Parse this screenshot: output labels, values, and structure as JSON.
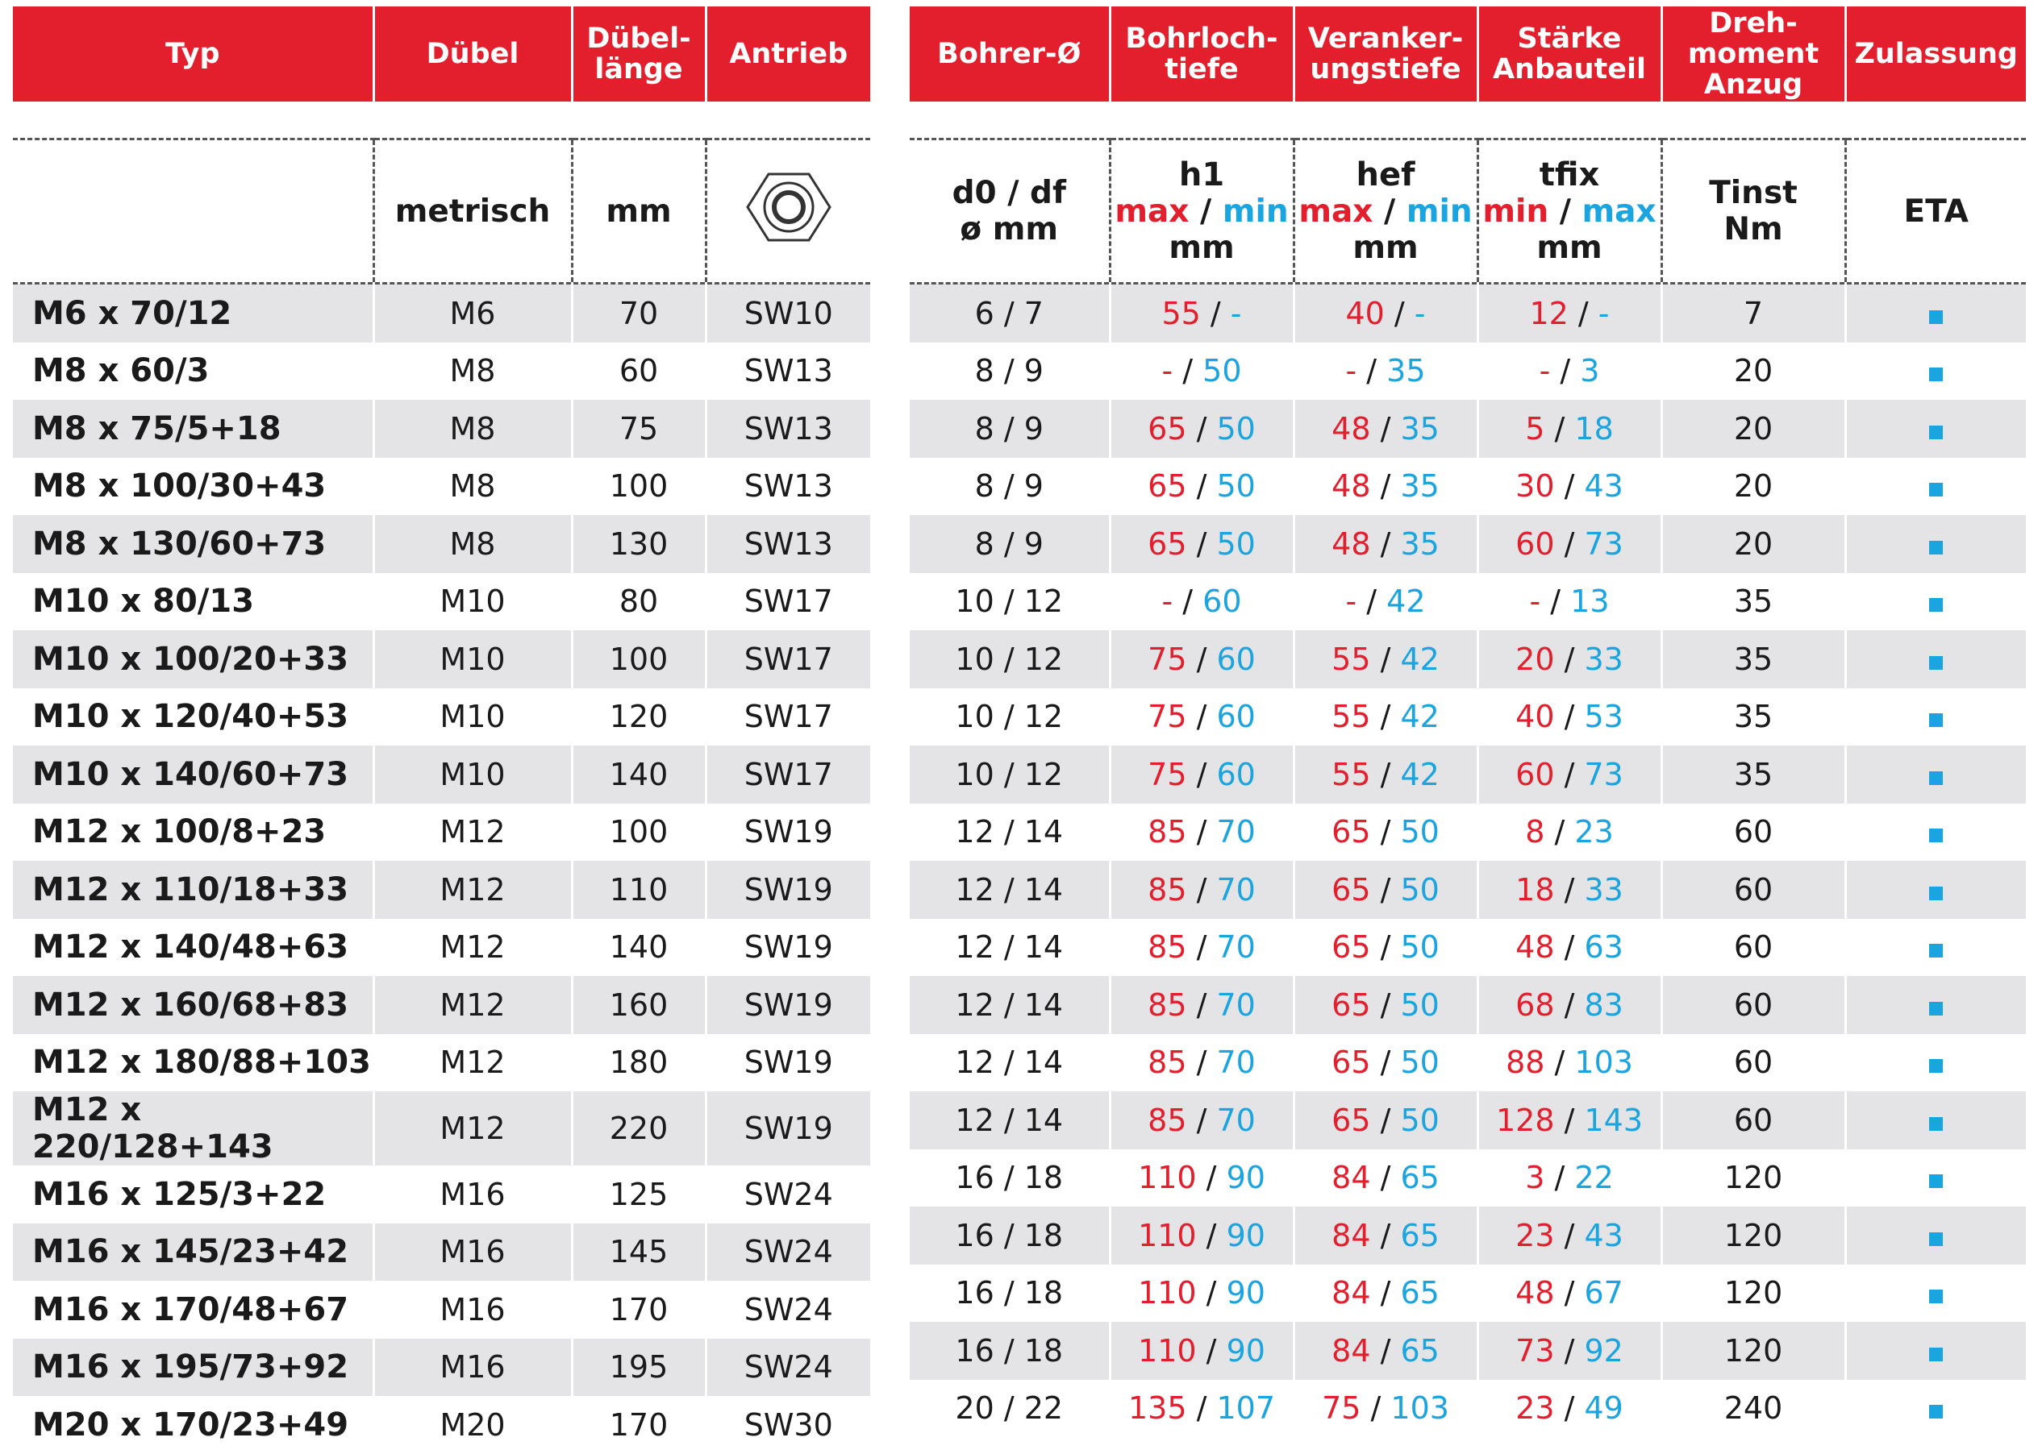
{
  "left_header": [
    "Typ",
    "Dübel",
    "Dübel-\nlänge",
    "Antrieb"
  ],
  "right_header": [
    "Bohrer-Ø",
    "Bohrloch-\ntiefe",
    "Veranker-\nungstiefe",
    "Stärke\nAnbauteil",
    "Dreh-\nmoment\nAnzug",
    "Zulassung"
  ],
  "units": {
    "metrisch": "metrisch",
    "mm": "mm",
    "drive_icon": "hex-nut-icon",
    "d0_df": "d0 / df",
    "d0_df_unit": "ø mm",
    "h1": "h1",
    "hef": "hef",
    "tfix": "tfix",
    "max": "max",
    "min": "min",
    "slash": " / ",
    "unit_mm": "mm",
    "tinst": "Tinst",
    "nm": "Nm",
    "eta": "ETA"
  },
  "colors": {
    "header_red": "#e31e2d",
    "max_red": "#e31e2d",
    "min_blue": "#1aa4e0",
    "stripe": "#e4e4e6"
  },
  "rows": [
    {
      "typ": "M6 x 70/12",
      "duebel": "M6",
      "laenge": "70",
      "antrieb": "SW10",
      "bohrer": "6 / 7",
      "h1": [
        "55",
        "-"
      ],
      "hef": [
        "40",
        "-"
      ],
      "tfix": [
        "12",
        "-"
      ],
      "tinst": "7"
    },
    {
      "typ": "M8 x 60/3",
      "duebel": "M8",
      "laenge": "60",
      "antrieb": "SW13",
      "bohrer": "8 / 9",
      "h1": [
        "-",
        "50"
      ],
      "hef": [
        "-",
        "35"
      ],
      "tfix": [
        "-",
        "3"
      ],
      "tinst": "20"
    },
    {
      "typ": "M8 x 75/5+18",
      "duebel": "M8",
      "laenge": "75",
      "antrieb": "SW13",
      "bohrer": "8 / 9",
      "h1": [
        "65",
        "50"
      ],
      "hef": [
        "48",
        "35"
      ],
      "tfix": [
        "5",
        "18"
      ],
      "tinst": "20"
    },
    {
      "typ": "M8 x 100/30+43",
      "duebel": "M8",
      "laenge": "100",
      "antrieb": "SW13",
      "bohrer": "8 / 9",
      "h1": [
        "65",
        "50"
      ],
      "hef": [
        "48",
        "35"
      ],
      "tfix": [
        "30",
        "43"
      ],
      "tinst": "20"
    },
    {
      "typ": "M8 x 130/60+73",
      "duebel": "M8",
      "laenge": "130",
      "antrieb": "SW13",
      "bohrer": "8 / 9",
      "h1": [
        "65",
        "50"
      ],
      "hef": [
        "48",
        "35"
      ],
      "tfix": [
        "60",
        "73"
      ],
      "tinst": "20"
    },
    {
      "typ": "M10 x 80/13",
      "duebel": "M10",
      "laenge": "80",
      "antrieb": "SW17",
      "bohrer": "10 / 12",
      "h1": [
        "-",
        "60"
      ],
      "hef": [
        "-",
        "42"
      ],
      "tfix": [
        "-",
        "13"
      ],
      "tinst": "35"
    },
    {
      "typ": "M10 x 100/20+33",
      "duebel": "M10",
      "laenge": "100",
      "antrieb": "SW17",
      "bohrer": "10 / 12",
      "h1": [
        "75",
        "60"
      ],
      "hef": [
        "55",
        "42"
      ],
      "tfix": [
        "20",
        "33"
      ],
      "tinst": "35"
    },
    {
      "typ": "M10 x 120/40+53",
      "duebel": "M10",
      "laenge": "120",
      "antrieb": "SW17",
      "bohrer": "10 / 12",
      "h1": [
        "75",
        "60"
      ],
      "hef": [
        "55",
        "42"
      ],
      "tfix": [
        "40",
        "53"
      ],
      "tinst": "35"
    },
    {
      "typ": "M10 x 140/60+73",
      "duebel": "M10",
      "laenge": "140",
      "antrieb": "SW17",
      "bohrer": "10 / 12",
      "h1": [
        "75",
        "60"
      ],
      "hef": [
        "55",
        "42"
      ],
      "tfix": [
        "60",
        "73"
      ],
      "tinst": "35"
    },
    {
      "typ": "M12 x 100/8+23",
      "duebel": "M12",
      "laenge": "100",
      "antrieb": "SW19",
      "bohrer": "12 / 14",
      "h1": [
        "85",
        "70"
      ],
      "hef": [
        "65",
        "50"
      ],
      "tfix": [
        "8",
        "23"
      ],
      "tinst": "60"
    },
    {
      "typ": "M12 x 110/18+33",
      "duebel": "M12",
      "laenge": "110",
      "antrieb": "SW19",
      "bohrer": "12 / 14",
      "h1": [
        "85",
        "70"
      ],
      "hef": [
        "65",
        "50"
      ],
      "tfix": [
        "18",
        "33"
      ],
      "tinst": "60"
    },
    {
      "typ": "M12 x 140/48+63",
      "duebel": "M12",
      "laenge": "140",
      "antrieb": "SW19",
      "bohrer": "12 / 14",
      "h1": [
        "85",
        "70"
      ],
      "hef": [
        "65",
        "50"
      ],
      "tfix": [
        "48",
        "63"
      ],
      "tinst": "60"
    },
    {
      "typ": "M12 x 160/68+83",
      "duebel": "M12",
      "laenge": "160",
      "antrieb": "SW19",
      "bohrer": "12 / 14",
      "h1": [
        "85",
        "70"
      ],
      "hef": [
        "65",
        "50"
      ],
      "tfix": [
        "68",
        "83"
      ],
      "tinst": "60"
    },
    {
      "typ": "M12 x 180/88+103",
      "duebel": "M12",
      "laenge": "180",
      "antrieb": "SW19",
      "bohrer": "12 / 14",
      "h1": [
        "85",
        "70"
      ],
      "hef": [
        "65",
        "50"
      ],
      "tfix": [
        "88",
        "103"
      ],
      "tinst": "60"
    },
    {
      "typ": "M12 x 220/128+143",
      "duebel": "M12",
      "laenge": "220",
      "antrieb": "SW19",
      "bohrer": "12 / 14",
      "h1": [
        "85",
        "70"
      ],
      "hef": [
        "65",
        "50"
      ],
      "tfix": [
        "128",
        "143"
      ],
      "tinst": "60"
    },
    {
      "typ": "M16 x 125/3+22",
      "duebel": "M16",
      "laenge": "125",
      "antrieb": "SW24",
      "bohrer": "16 / 18",
      "h1": [
        "110",
        "90"
      ],
      "hef": [
        "84",
        "65"
      ],
      "tfix": [
        "3",
        "22"
      ],
      "tinst": "120"
    },
    {
      "typ": "M16 x 145/23+42",
      "duebel": "M16",
      "laenge": "145",
      "antrieb": "SW24",
      "bohrer": "16 / 18",
      "h1": [
        "110",
        "90"
      ],
      "hef": [
        "84",
        "65"
      ],
      "tfix": [
        "23",
        "43"
      ],
      "tinst": "120"
    },
    {
      "typ": "M16 x 170/48+67",
      "duebel": "M16",
      "laenge": "170",
      "antrieb": "SW24",
      "bohrer": "16 / 18",
      "h1": [
        "110",
        "90"
      ],
      "hef": [
        "84",
        "65"
      ],
      "tfix": [
        "48",
        "67"
      ],
      "tinst": "120"
    },
    {
      "typ": "M16 x 195/73+92",
      "duebel": "M16",
      "laenge": "195",
      "antrieb": "SW24",
      "bohrer": "16 / 18",
      "h1": [
        "110",
        "90"
      ],
      "hef": [
        "84",
        "65"
      ],
      "tfix": [
        "73",
        "92"
      ],
      "tinst": "120"
    },
    {
      "typ": "M20 x 170/23+49",
      "duebel": "M20",
      "laenge": "170",
      "antrieb": "SW30",
      "bohrer": "20 / 22",
      "h1": [
        "135",
        "107"
      ],
      "hef": [
        "75",
        "103"
      ],
      "tfix": [
        "23",
        "49"
      ],
      "tinst": "240"
    }
  ]
}
